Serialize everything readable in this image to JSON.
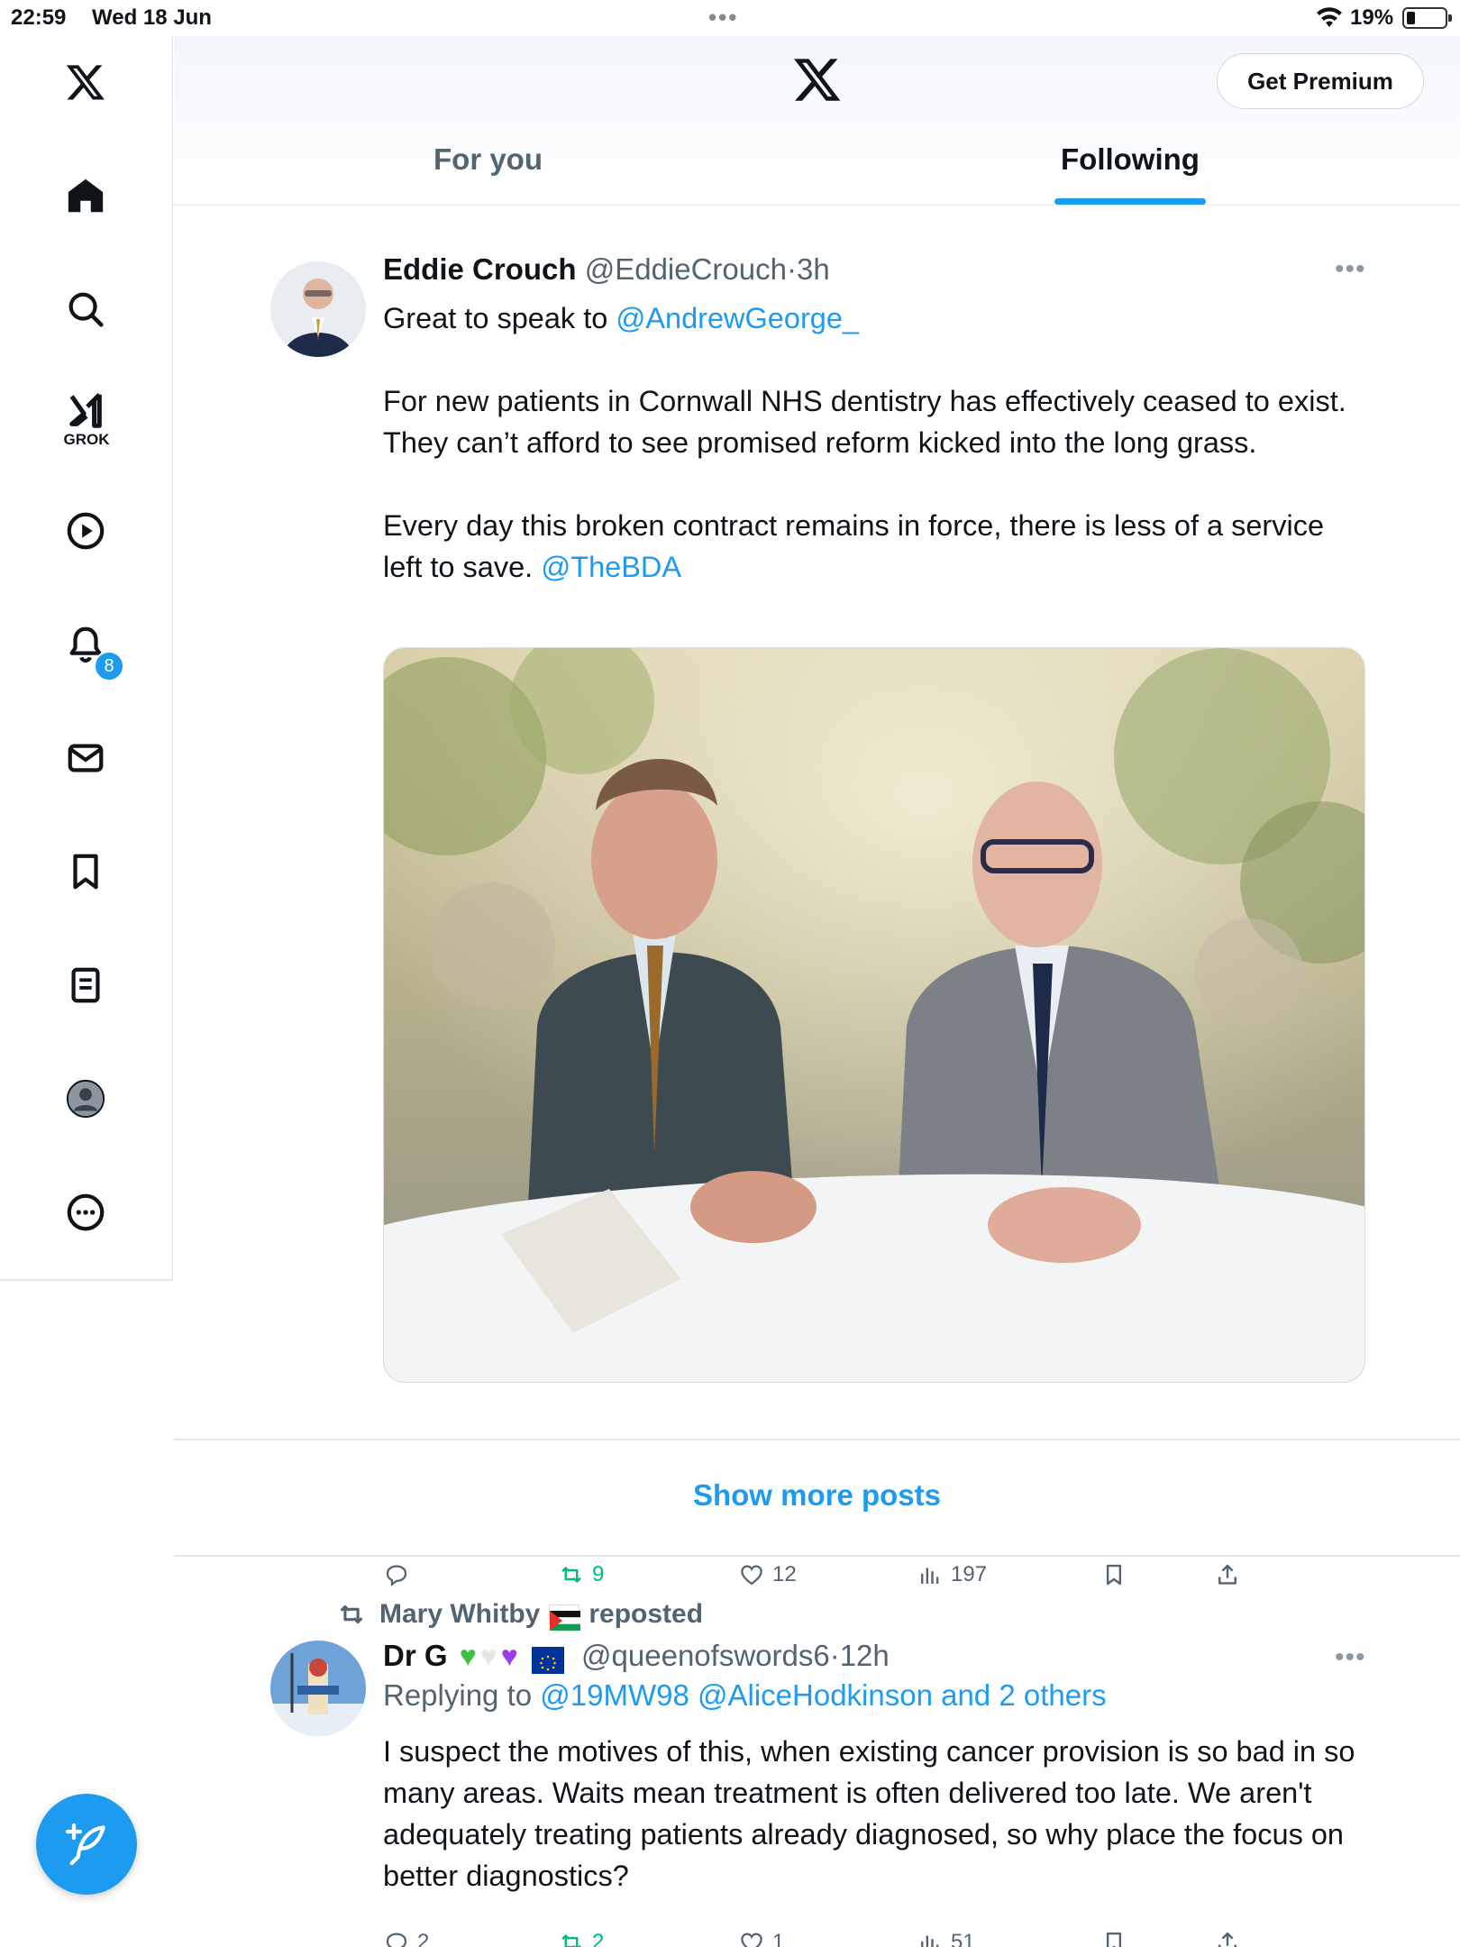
{
  "status_bar": {
    "time": "22:59",
    "date": "Wed 18 Jun",
    "battery": "19%"
  },
  "sidebar": {
    "grok_label": "GROK",
    "notifications_count": "8"
  },
  "header": {
    "premium_label": "Get Premium",
    "tabs": [
      {
        "label": "For you",
        "selected": false
      },
      {
        "label": "Following",
        "selected": true
      }
    ]
  },
  "post1": {
    "name": "Eddie Crouch",
    "handle": "@EddieCrouch",
    "time": "3h",
    "text_intro": "Great to speak to ",
    "mention1": "@AndrewGeorge_",
    "para2": "For new patients in Cornwall NHS dentistry has effectively ceased to exist. They can’t afford to see promised reform kicked into the long grass.",
    "para3": "Every day this broken contract remains in force, there is less of a service left to save. ",
    "mention2": "@TheBDA",
    "reposts": "9",
    "likes": "12",
    "views": "197"
  },
  "show_more": "Show more posts",
  "post2": {
    "reposted_by": "Mary Whitby",
    "reposted_label": "reposted",
    "name": "Dr G",
    "handle": "@queenofswords6",
    "time": "12h",
    "replying_label": "Replying to ",
    "replying_mentions": "@19MW98 @AliceHodkinson and 2 others",
    "text": "I suspect the motives of this, when existing cancer provision is so bad in so many areas. Waits mean treatment is often delivered too late. We aren't adequately treating patients already diagnosed, so why place the focus on better diagnostics?",
    "replies": "2",
    "reposts": "2",
    "likes": "1",
    "views": "51"
  },
  "colors": {
    "accent": "#1d9bf0",
    "repost_green": "#00ba7c",
    "muted": "#536471"
  }
}
